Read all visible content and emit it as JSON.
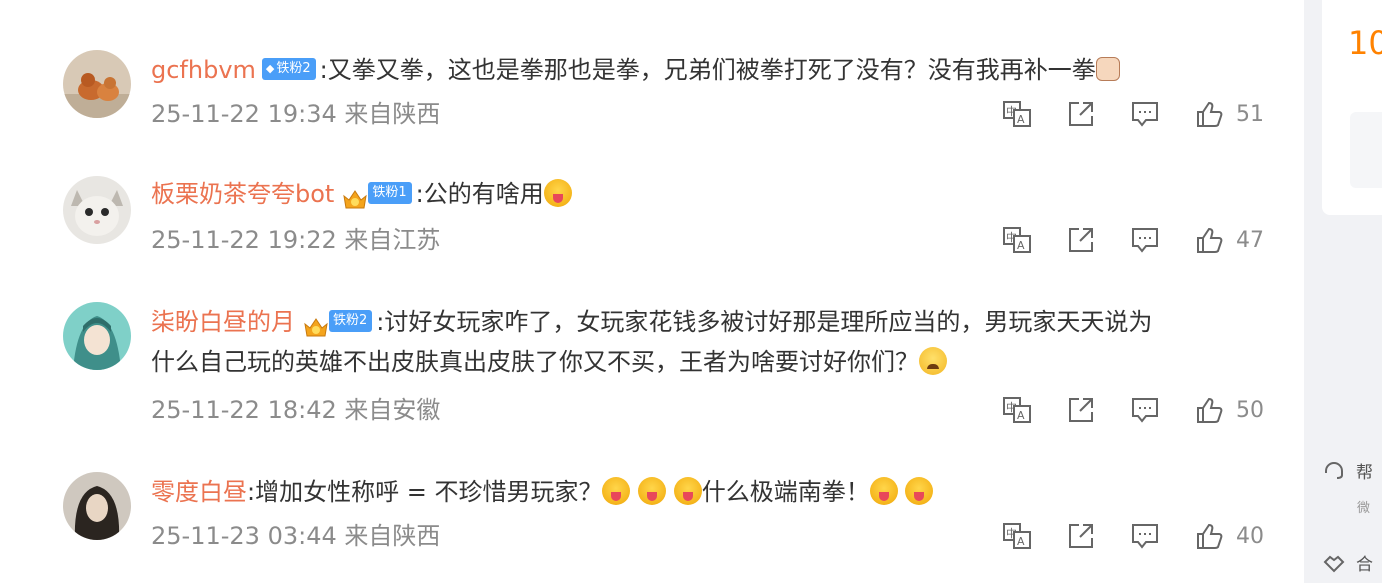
{
  "comments": [
    {
      "username": "gcfhbvm",
      "badge": "铁粉2",
      "text": "又拳又拳，这也是拳那也是拳，兄弟们被拳打死了没有？没有我再补一拳",
      "time": "25-11-22 19:34",
      "location": "来自陕西",
      "likes": "51"
    },
    {
      "username": "板栗奶茶夸夸bot",
      "badge": "铁粉1",
      "text": "公的有啥用",
      "time": "25-11-22 19:22",
      "location": "来自江苏",
      "likes": "47"
    },
    {
      "username": "柒盼白昼的月",
      "badge": "铁粉2",
      "text_line1": "讨好女玩家咋了，女玩家花钱多被讨好那是理所应当的，男玩家天天说为",
      "text_line2": "什么自己玩的英雄不出皮肤真出皮肤了你又不买，王者为啥要讨好你们？",
      "time": "25-11-22 18:42",
      "location": "来自安徽",
      "likes": "50"
    },
    {
      "username": "零度白昼",
      "text_a": "增加女性称呼 = 不珍惜男玩家？",
      "text_b": "什么极端南拳！",
      "time": "25-11-23 03:44",
      "location": "来自陕西",
      "likes": "40"
    }
  ],
  "colon": ":",
  "sidebar": {
    "number": "10",
    "help_label": "帮",
    "help_sub": "微",
    "coop_label": "合"
  },
  "colors": {
    "username": "#eb7350",
    "badge_blue": "#4a9ef8",
    "meta_gray": "#8b8b8b",
    "accent_orange": "#ff8200"
  },
  "icons": [
    "translate-icon",
    "share-icon",
    "comment-icon",
    "like-icon",
    "gem-icon",
    "crown-icon"
  ]
}
